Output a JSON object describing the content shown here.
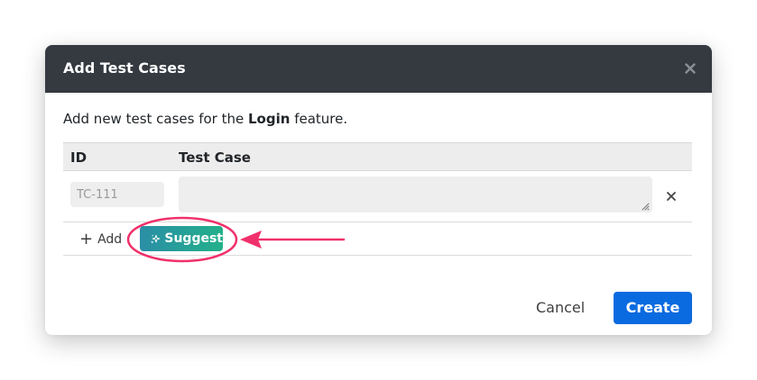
{
  "modal": {
    "title": "Add Test Cases",
    "intro_prefix": "Add new test cases for the ",
    "feature_name": "Login",
    "intro_suffix": " feature."
  },
  "table": {
    "columns": [
      "ID",
      "Test Case"
    ],
    "rows": [
      {
        "id_placeholder": "TC-111",
        "case_value": ""
      }
    ]
  },
  "actions": {
    "add_label": "Add",
    "suggest_label": "Suggest"
  },
  "footer": {
    "cancel_label": "Cancel",
    "create_label": "Create"
  },
  "colors": {
    "header_bg": "#343a40",
    "primary": "#0a6ae0",
    "suggest_gradient_start": "#2a8ea6",
    "suggest_gradient_end": "#23b08a",
    "annotation": "#f0306a"
  },
  "icons": [
    "close-icon",
    "remove-row-icon",
    "plus-icon",
    "sparkle-icon",
    "resize-grip-icon"
  ]
}
